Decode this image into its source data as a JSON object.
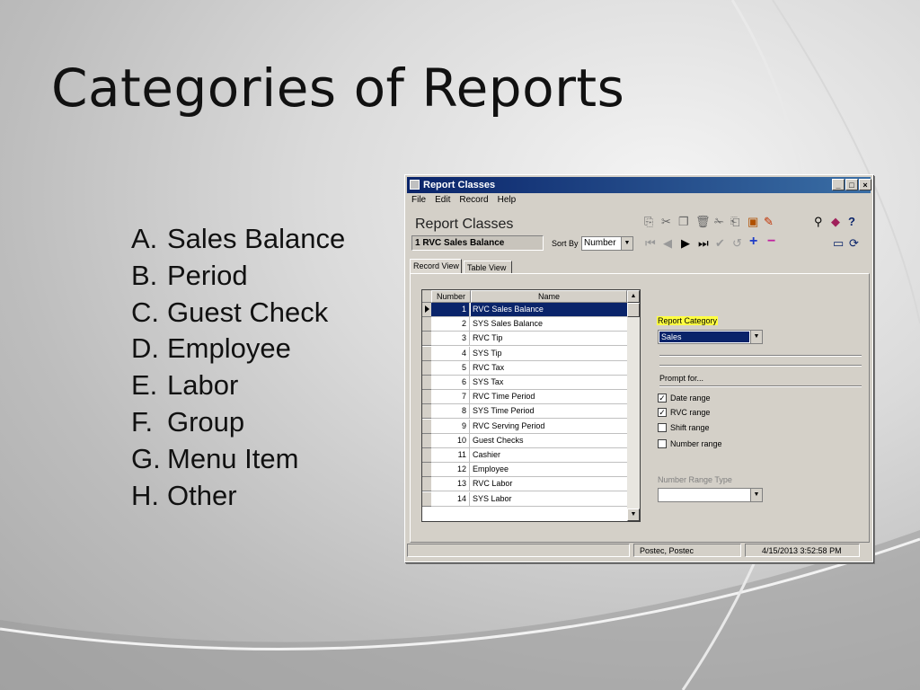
{
  "slide": {
    "title": "Categories of Reports",
    "items": [
      {
        "letter": "A.",
        "label": "Sales Balance"
      },
      {
        "letter": "B.",
        "label": "Period"
      },
      {
        "letter": "C.",
        "label": "Guest Check"
      },
      {
        "letter": "D.",
        "label": "Employee"
      },
      {
        "letter": "E.",
        "label": "Labor"
      },
      {
        "letter": "F.",
        "label": "Group"
      },
      {
        "letter": "G.",
        "label": "Menu Item"
      },
      {
        "letter": "H.",
        "label": "Other"
      }
    ]
  },
  "window": {
    "title": "Report Classes",
    "menu": [
      "File",
      "Edit",
      "Record",
      "Help"
    ],
    "header_title": "Report Classes",
    "current_record": "1 RVC Sales Balance",
    "sort_by_label": "Sort By",
    "sort_by_value": "Number",
    "tabs": [
      "Record View",
      "Table View"
    ],
    "grid": {
      "columns": [
        "Number",
        "Name"
      ],
      "rows": [
        {
          "number": "1",
          "name": "RVC Sales Balance"
        },
        {
          "number": "2",
          "name": "SYS Sales Balance"
        },
        {
          "number": "3",
          "name": "RVC Tip"
        },
        {
          "number": "4",
          "name": "SYS Tip"
        },
        {
          "number": "5",
          "name": "RVC Tax"
        },
        {
          "number": "6",
          "name": "SYS Tax"
        },
        {
          "number": "7",
          "name": "RVC Time Period"
        },
        {
          "number": "8",
          "name": "SYS Time Period"
        },
        {
          "number": "9",
          "name": "RVC Serving Period"
        },
        {
          "number": "10",
          "name": "Guest Checks"
        },
        {
          "number": "11",
          "name": "Cashier"
        },
        {
          "number": "12",
          "name": "Employee"
        },
        {
          "number": "13",
          "name": "RVC Labor"
        },
        {
          "number": "14",
          "name": "SYS Labor"
        }
      ]
    },
    "report_category_label": "Report Category",
    "report_category_value": "Sales",
    "prompt_for_label": "Prompt for...",
    "checks": [
      {
        "label": "Date range",
        "checked": true
      },
      {
        "label": "RVC range",
        "checked": true
      },
      {
        "label": "Shift range",
        "checked": false
      },
      {
        "label": "Number range",
        "checked": false
      }
    ],
    "number_range_type_label": "Number Range Type",
    "status": {
      "user": "Postec, Postec",
      "datetime": "4/15/2013 3:52:58 PM"
    }
  }
}
